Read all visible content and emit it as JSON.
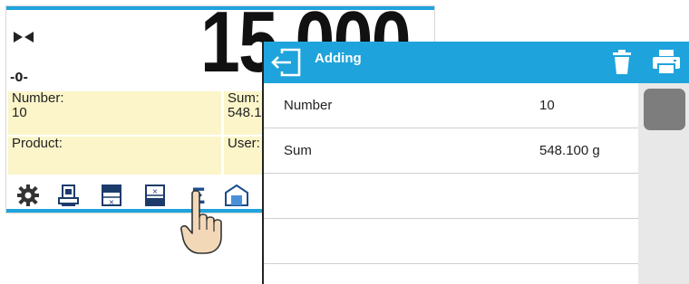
{
  "background_screen": {
    "weight_value": "15.000",
    "zero_indicator": "-0-",
    "info": {
      "number_label": "Number:",
      "number_value": "10",
      "sum_label": "Sum:",
      "sum_value": "548.1",
      "product_label": "Product:",
      "user_label": "User:"
    },
    "toolbar": [
      "settings-icon",
      "tare-icon",
      "checkweighing-icon",
      "counting-icon",
      "sum-icon",
      "warehouse-icon"
    ]
  },
  "dialog": {
    "title": "Adding",
    "rows": [
      {
        "label": "Number",
        "value": "10"
      },
      {
        "label": "Sum",
        "value": "548.100 g"
      },
      {
        "label": "",
        "value": ""
      },
      {
        "label": "",
        "value": ""
      },
      {
        "label": "",
        "value": ""
      }
    ]
  },
  "colors": {
    "accent": "#1fa3dc",
    "info_box": "#fbf5c9",
    "scroll_thumb": "#7d7d7d"
  }
}
